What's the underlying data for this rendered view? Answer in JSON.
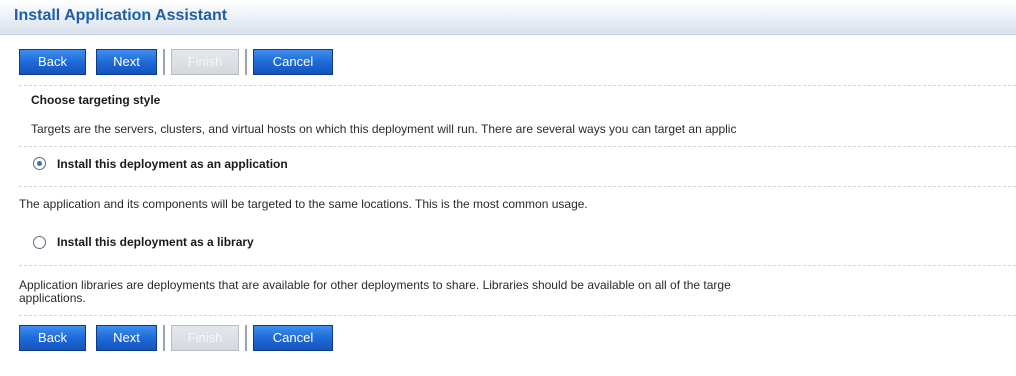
{
  "window": {
    "title": "Install Application Assistant"
  },
  "toolbar": {
    "back_label": "Back",
    "next_label": "Next",
    "finish_label": "Finish",
    "cancel_label": "Cancel"
  },
  "section": {
    "heading": "Choose targeting style",
    "description": "Targets are the servers, clusters, and virtual hosts on which this deployment will run. There are several ways you can target an applic"
  },
  "options": [
    {
      "label": "Install this deployment as an application",
      "selected": true,
      "description": "The application and its components will be targeted to the same locations. This is the most common usage."
    },
    {
      "label": "Install this deployment as a library",
      "selected": false,
      "description_line1": "Application libraries are deployments that are available for other deployments to share. Libraries should be available on all of the targe",
      "description_line2": "applications."
    }
  ],
  "colors": {
    "title": "#1e5ea8",
    "button": "#1f6ad8",
    "button_disabled": "#d5d9de"
  }
}
